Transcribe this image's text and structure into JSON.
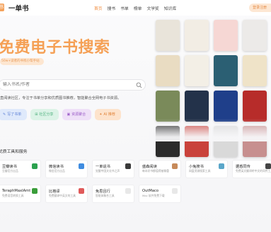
{
  "header": {
    "logo_glyph": "书",
    "logo_text": "一单书",
    "nav": [
      "首页",
      "搜书",
      "书单",
      "榜单",
      "文学奖",
      "知识库"
    ],
    "login": "登录注册"
  },
  "hero": {
    "title": "免费电子书搜索",
    "subtitle": "50w+读者的书找小帮手站"
  },
  "search": {
    "placeholder": "输入书名/作者"
  },
  "description": "直阅读社区，专注于书单分享和优质图书推荐，智能聚合全网电子书资源。",
  "chips": [
    {
      "icon": "✎",
      "label": "写了书单"
    },
    {
      "icon": "⊞",
      "label": "社区分享"
    },
    {
      "icon": "▣",
      "label": "资源聚合"
    },
    {
      "icon": "✦",
      "label": "AI 推荐"
    }
  ],
  "books": [
    {
      "title": "",
      "color": "#e9e4da"
    },
    {
      "title": "",
      "color": "#f2ede4"
    },
    {
      "title": "",
      "color": "#f6d7d4"
    },
    {
      "title": "",
      "color": "#eceae8"
    },
    {
      "title": "",
      "color": "#e9dcc2"
    },
    {
      "title": "",
      "color": "#f3efe6"
    },
    {
      "title": "",
      "color": "#2b5f73"
    },
    {
      "title": "",
      "color": "#efe3c8"
    },
    {
      "title": "",
      "color": "#7a8a5a"
    },
    {
      "title": "",
      "color": "#23324a"
    },
    {
      "title": "",
      "color": "#1f3f8a"
    },
    {
      "title": "",
      "color": "#b72c2a"
    },
    {
      "title": "",
      "color": "#2a2a2a"
    },
    {
      "title": "",
      "color": "#c9423b"
    },
    {
      "title": "",
      "color": "#d9d9d9"
    },
    {
      "title": "",
      "color": "#c78f8f"
    }
  ],
  "tools_section": "优质工具和服务",
  "tools": [
    {
      "name": "豆瓣读书",
      "desc": "豆瓣官方出品",
      "icon_color": "#2ca24f",
      "icon": "douban-icon"
    },
    {
      "name": "微信读书",
      "desc": "微信官方出品",
      "icon_color": "#3f8ce0",
      "icon": "wechat-read-icon"
    },
    {
      "name": "一单说书",
      "desc": "觉醒中国文化书之声",
      "icon_color": "#3a3a3a",
      "icon": "shuo-icon"
    },
    {
      "name": "盛森阅读",
      "desc": "每本好书都值得被尊重",
      "icon_color": "#c78a5a",
      "icon": "avatar-icon"
    },
    {
      "name": "小兔搜书",
      "desc": "网盘资源搜索工具",
      "icon_color": "#5aa6c9",
      "icon": "rabbit-icon"
    },
    {
      "name": "据悉同传",
      "desc": "免费英文翻译转中文的同传工具",
      "icon_color": "#444444",
      "icon": "translate-icon"
    },
    {
      "name": "TeraphMaxIAmt",
      "desc": "免费语音转换工具",
      "icon_color": "#3a9d3a",
      "icon": "tera-icon"
    },
    {
      "name": "比格译",
      "desc": "免费翻译中英文的工具",
      "icon_color": "#e05a5a",
      "icon": "translate2-icon"
    },
    {
      "name": "免思且行",
      "desc": "智能体聚合工具",
      "icon_color": "#e8e8e8",
      "icon": "agent-icon"
    },
    {
      "name": "OutMaco",
      "desc": "Mac 软件免费下载",
      "icon_color": "#e8e8e8",
      "icon": "mac-icon"
    }
  ]
}
